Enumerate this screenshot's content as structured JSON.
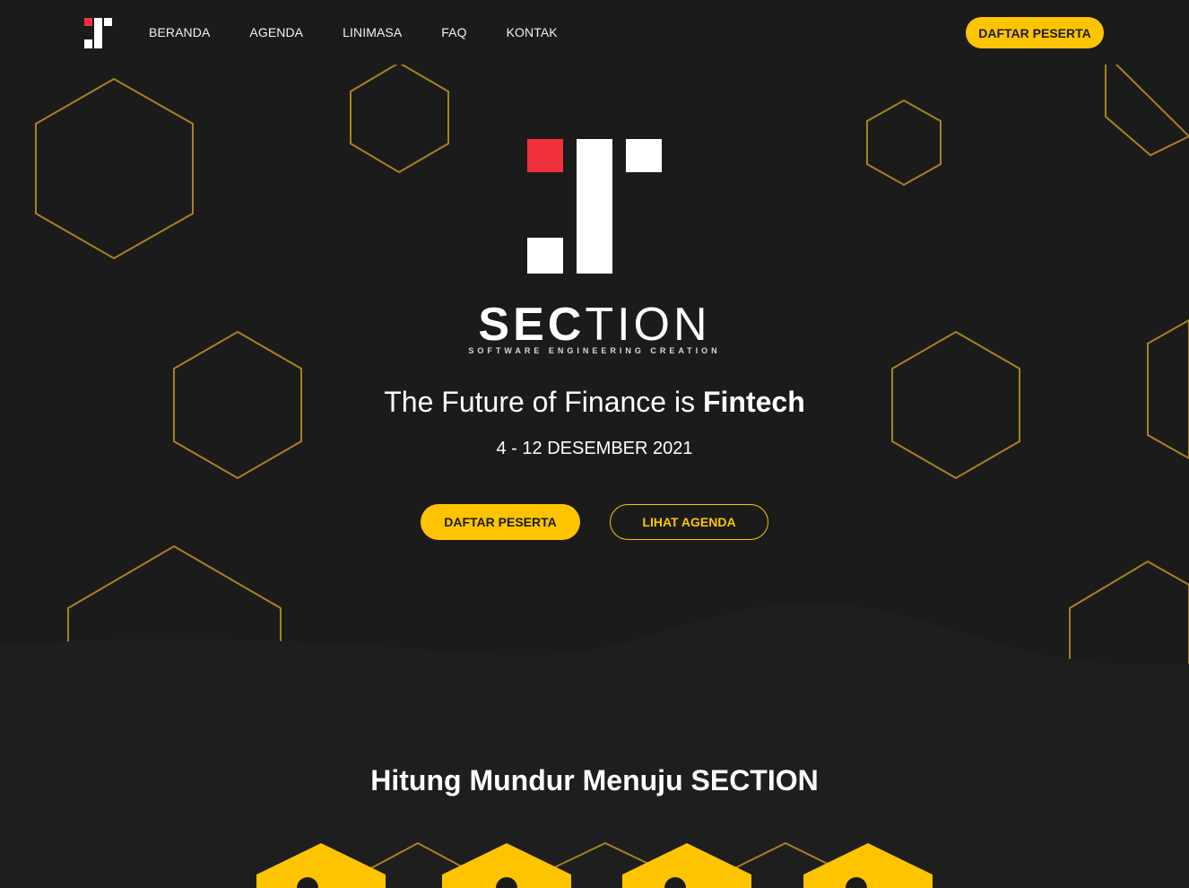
{
  "nav": {
    "links": [
      "BERANDA",
      "AGENDA",
      "LINIMASA",
      "FAQ",
      "KONTAK"
    ],
    "cta_label": "DAFTAR PESERTA"
  },
  "hero": {
    "brand_bold": "SEC",
    "brand_thin": "TION",
    "brand_tagline": "SOFTWARE ENGINEERING CREATION",
    "headline_prefix": "The Future of Finance is ",
    "headline_emphasis": "Fintech",
    "date": "4 - 12 DESEMBER 2021",
    "primary_button": "DAFTAR PESERTA",
    "secondary_button": "LIHAT AGENDA"
  },
  "countdown": {
    "title": "Hitung Mundur Menuju SECTION"
  },
  "colors": {
    "background": "#1b1b1b",
    "accent": "#ffc400",
    "logo_red": "#f0313d",
    "hex_outline": "#a8811f"
  },
  "icons": {
    "logo": "section-logo-icon"
  }
}
